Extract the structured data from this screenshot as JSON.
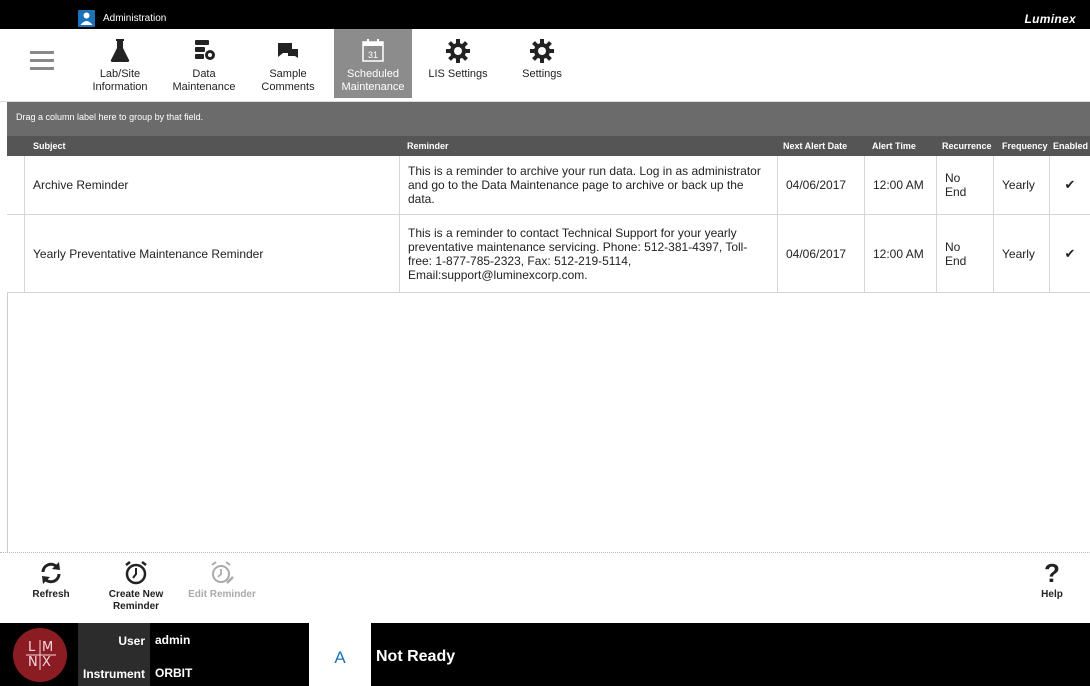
{
  "titlebar": {
    "title": "Administration",
    "brand": "Luminex"
  },
  "ribbon": {
    "tabs": [
      {
        "label": "Lab/Site\nInformation",
        "icon": "flask-icon"
      },
      {
        "label": "Data\nMaintenance",
        "icon": "data-maintenance-icon"
      },
      {
        "label": "Sample\nComments",
        "icon": "comments-icon"
      },
      {
        "label": "Scheduled\nMaintenance",
        "icon": "calendar-icon",
        "active": true,
        "day": "31"
      },
      {
        "label": "LIS Settings",
        "icon": "gear-icon"
      },
      {
        "label": "Settings",
        "icon": "gear-icon"
      }
    ]
  },
  "grid": {
    "group_hint": "Drag a column label here to group by that field.",
    "columns": {
      "subject": "Subject",
      "reminder": "Reminder",
      "next_alert_date": "Next Alert Date",
      "alert_time": "Alert Time",
      "recurrence": "Recurrence",
      "frequency": "Frequency",
      "enabled": "Enabled"
    },
    "rows": [
      {
        "subject": "Archive Reminder",
        "reminder": "This is a reminder to archive your run data. Log in as administrator and go to the Data Maintenance page to archive or back up the data.",
        "next_alert_date": "04/06/2017",
        "alert_time": "12:00 AM",
        "recurrence": "No End",
        "frequency": "Yearly",
        "enabled": "✔"
      },
      {
        "subject": "Yearly Preventative Maintenance Reminder",
        "reminder": "This is a reminder to contact Technical Support for your yearly preventative maintenance servicing. Phone: 512-381-4397, Toll-free: 1-877-785-2323, Fax: 512-219-5114, Email:support@luminexcorp.com.",
        "next_alert_date": "04/06/2017",
        "alert_time": "12:00 AM",
        "recurrence": "No End",
        "frequency": "Yearly",
        "enabled": "✔"
      }
    ]
  },
  "toolbar": {
    "refresh": "Refresh",
    "create": "Create New\nReminder",
    "edit": "Edit Reminder",
    "help": "Help"
  },
  "status": {
    "logo_letters": [
      "L",
      "M",
      "N",
      "X"
    ],
    "user_label": "User",
    "user_value": "admin",
    "instrument_label": "Instrument",
    "instrument_value": "ORBIT",
    "state_letter": "A",
    "state_text": "Not Ready"
  }
}
